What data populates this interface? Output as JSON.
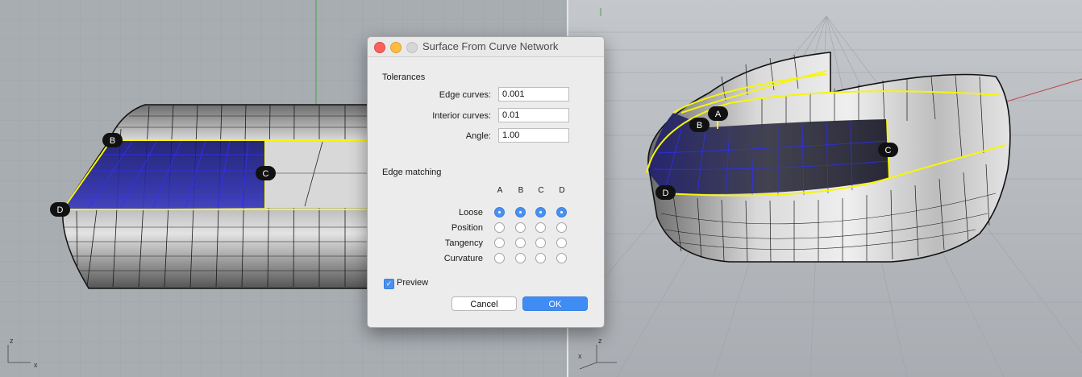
{
  "dialog": {
    "title": "Surface From Curve Network",
    "tolerances_heading": "Tolerances",
    "fields": [
      {
        "label": "Edge curves:",
        "value": "0.001"
      },
      {
        "label": "Interior curves:",
        "value": "0.01"
      },
      {
        "label": "Angle:",
        "value": "1.00"
      }
    ],
    "edge_matching_heading": "Edge matching",
    "columns": [
      "A",
      "B",
      "C",
      "D"
    ],
    "rows": [
      {
        "label": "Loose",
        "selected": true
      },
      {
        "label": "Position",
        "selected": false
      },
      {
        "label": "Tangency",
        "selected": false
      },
      {
        "label": "Curvature",
        "selected": false
      }
    ],
    "preview_label": "Preview",
    "preview_checked": true,
    "cancel_label": "Cancel",
    "ok_label": "OK"
  },
  "viewports": {
    "left": {
      "labels": [
        "B",
        "C",
        "D"
      ],
      "axis_z": "z",
      "axis_x": "x"
    },
    "right": {
      "labels": [
        "A",
        "B",
        "C",
        "D"
      ],
      "axis_z": "z",
      "axis_x": "x"
    }
  },
  "colors": {
    "accent": "#4a90ee",
    "curve": "#f7f50a",
    "selection": "#1c1c9c"
  }
}
